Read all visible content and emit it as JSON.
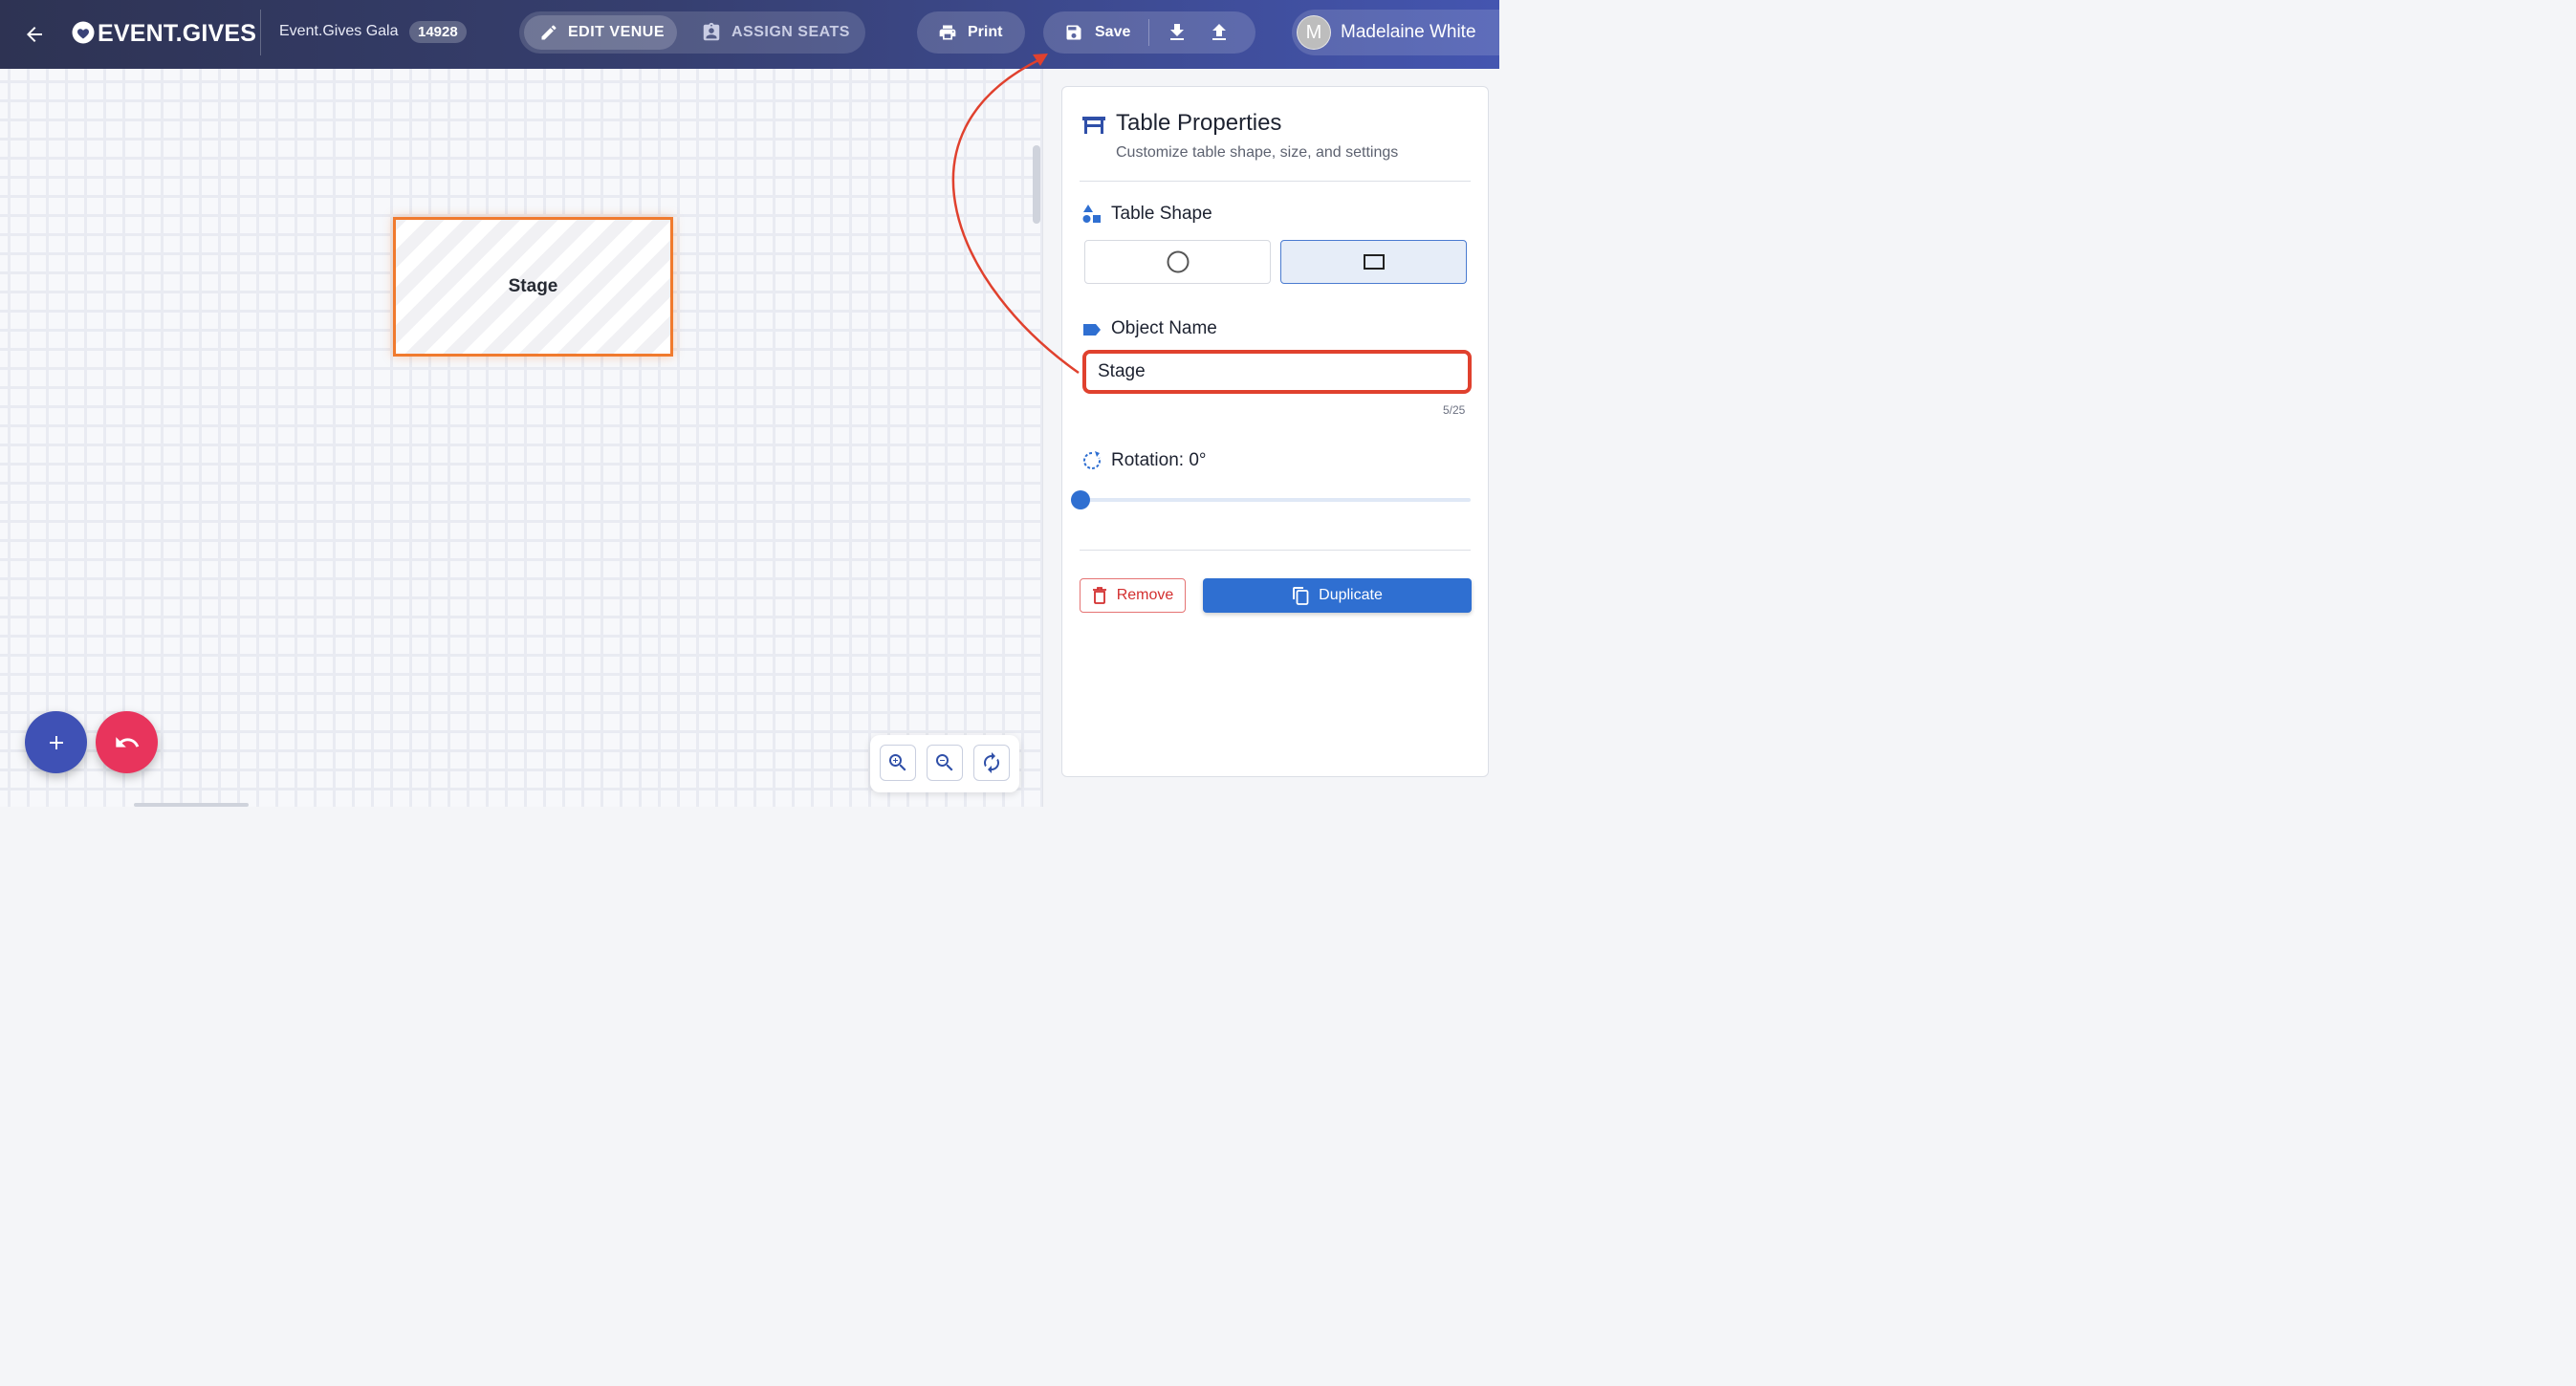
{
  "header": {
    "logo_text": "EVENT.GIVES",
    "event_name": "Event.Gives Gala",
    "event_id": "14928",
    "mode_edit_label": "EDIT VENUE",
    "mode_assign_label": "ASSIGN SEATS",
    "print_label": "Print",
    "save_label": "Save",
    "user_initial": "M",
    "user_name": "Madelaine White"
  },
  "canvas": {
    "selected_object_label": "Stage"
  },
  "panel": {
    "title": "Table Properties",
    "subtitle": "Customize table shape, size, and settings",
    "shape_label": "Table Shape",
    "shape_options": [
      "round",
      "rectangle"
    ],
    "shape_selected": "rectangle",
    "name_label": "Object Name",
    "name_value": "Stage",
    "name_counter": "5/25",
    "rotation_label": "Rotation: 0°",
    "rotation_value": 0,
    "remove_label": "Remove",
    "duplicate_label": "Duplicate"
  },
  "colors": {
    "header_start": "#2e3353",
    "header_end": "#4455b0",
    "selection_orange": "#f07a2e",
    "annotation_red": "#e0412e",
    "primary_blue": "#2f6fd1",
    "fab_add": "#3f51b5",
    "fab_undo": "#e8345c"
  }
}
